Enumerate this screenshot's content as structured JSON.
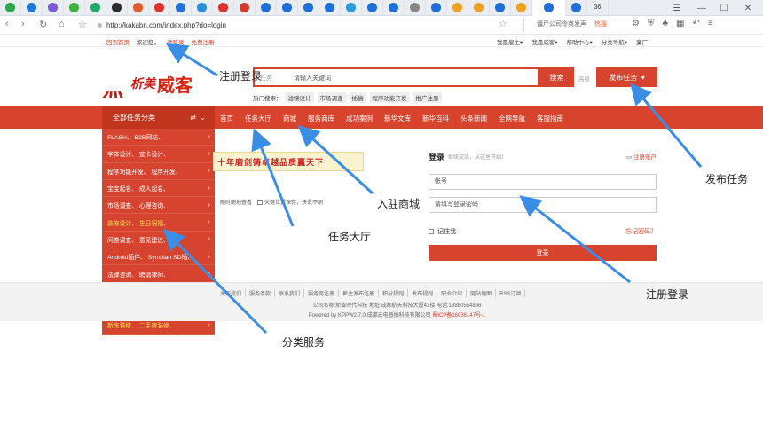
{
  "browser": {
    "url": "http://kakabn.com/index.php?do=login",
    "search_hint": "僵尸公司令商发声",
    "hot_label": "热搜",
    "tab_count": "36",
    "tabs": [
      {
        "color": "#2aa84a"
      },
      {
        "color": "#1f77d9"
      },
      {
        "color": "#7b5bd6"
      },
      {
        "color": "#3bb33f"
      },
      {
        "color": "#1faa6a"
      },
      {
        "color": "#2a2a2a"
      },
      {
        "color": "#e35a2c"
      },
      {
        "color": "#e0312a"
      },
      {
        "color": "#2670d9"
      },
      {
        "color": "#2a8fd8"
      },
      {
        "color": "#e0312a"
      },
      {
        "color": "#d43a2a"
      },
      {
        "color": "#1e6fd9"
      },
      {
        "color": "#1e6fd9"
      },
      {
        "color": "#1e6fd9"
      },
      {
        "color": "#1e6fd9"
      },
      {
        "color": "#2c9dd9"
      },
      {
        "color": "#1e6fd9"
      },
      {
        "color": "#1e6fd9"
      },
      {
        "color": "#888888"
      },
      {
        "color": "#1e6fd9"
      },
      {
        "color": "#f0a020"
      },
      {
        "color": "#f0a020"
      },
      {
        "color": "#1e6fd9"
      },
      {
        "color": "#f0a020"
      },
      {
        "color": "#1e6fd9"
      },
      {
        "color": "#1e6fd9"
      }
    ]
  },
  "topbar": {
    "home": "回到首页",
    "welcome": "欢迎您，",
    "login": "请登录",
    "register": "免费注册",
    "right": [
      "我是雇主▾",
      "我是威客▾",
      "帮助中心▾",
      "分类导航▾",
      "案厂"
    ]
  },
  "logo": {
    "part1": "灬",
    "part2": "析美",
    "part3": "威客"
  },
  "search": {
    "type": "任务",
    "placeholder": "请输入关键词",
    "button": "搜索",
    "advanced": "高级",
    "publish": "发布任务"
  },
  "hot": {
    "label": "热门搜索：",
    "tags": [
      "滤镜设计",
      "市场调查",
      "插稿",
      "程序功能开发",
      "推广注册"
    ]
  },
  "nav": {
    "category_button": "全部任务分类",
    "items": [
      "首页",
      "任务大厅",
      "商城",
      "服务商库",
      "成功案例",
      "新华文库",
      "新华百科",
      "头条新闻",
      "全网导航",
      "客服指南"
    ]
  },
  "categories": [
    {
      "label": "FLASH、  B2B网站、",
      "yellow": false
    },
    {
      "label": "字体设计、  宣卡设计、",
      "yellow": false
    },
    {
      "label": "程序功能开发、  程序开发、",
      "yellow": false
    },
    {
      "label": "宝宝起名、  成人起名、",
      "yellow": false
    },
    {
      "label": "市场调查、  心理咨询、",
      "yellow": false
    },
    {
      "label": "装修设计、  生日祝福、",
      "yellow": true
    },
    {
      "label": "问卷调查、  意见建议、",
      "yellow": false
    },
    {
      "label": "Android插件、  Symblan SD插、",
      "yellow": false
    },
    {
      "label": "法律咨询、  聘请律师、",
      "yellow": false
    },
    {
      "label": "搜索引擎优化、  论坛推广、",
      "yellow": false
    },
    {
      "label": "网游创意、  手机游戏、",
      "yellow": true
    },
    {
      "label": "新房装修、  二手房装修、",
      "yellow": true
    }
  ],
  "banner": {
    "text": "十年磨剑铸卓越品质赢天下"
  },
  "options": {
    "opt1": "，随时随地查看",
    "opt2": "关键位置保存，快丢不刷"
  },
  "login": {
    "title": "登录",
    "subtitle": "继续交流，从这里开始）",
    "register": "注册账户",
    "account_ph": "帐号",
    "password_ph": "请填写登录密码",
    "remember": "记住我",
    "forgot": "忘记密码？",
    "submit": "登录"
  },
  "footer": {
    "links": [
      "关于我们",
      "服务条款",
      "联系我们",
      "服务商注册",
      "雇主发布注册",
      "积分规则",
      "发布规则",
      "职业介绍",
      "网站地图",
      "RSS订阅"
    ],
    "line2": "公司名称:新省时代科技 地址:成都航天科技大厦43楼 电话:13880554866",
    "line3_prefix": "Powered by KPPW2.7.0 成都云电普拍科技有限公司",
    "line3_icp": "蜀ICP备16036147号-1"
  },
  "annotations": {
    "reg_top": "注册登录",
    "publish": "发布任务",
    "mall": "入驻商城",
    "hall": "任务大厅",
    "reg_bottom": "注册登录",
    "category": "分类服务"
  },
  "colors": {
    "accent": "#d8432d",
    "menu": "#d6432e",
    "arrow": "#3a8ee6"
  }
}
